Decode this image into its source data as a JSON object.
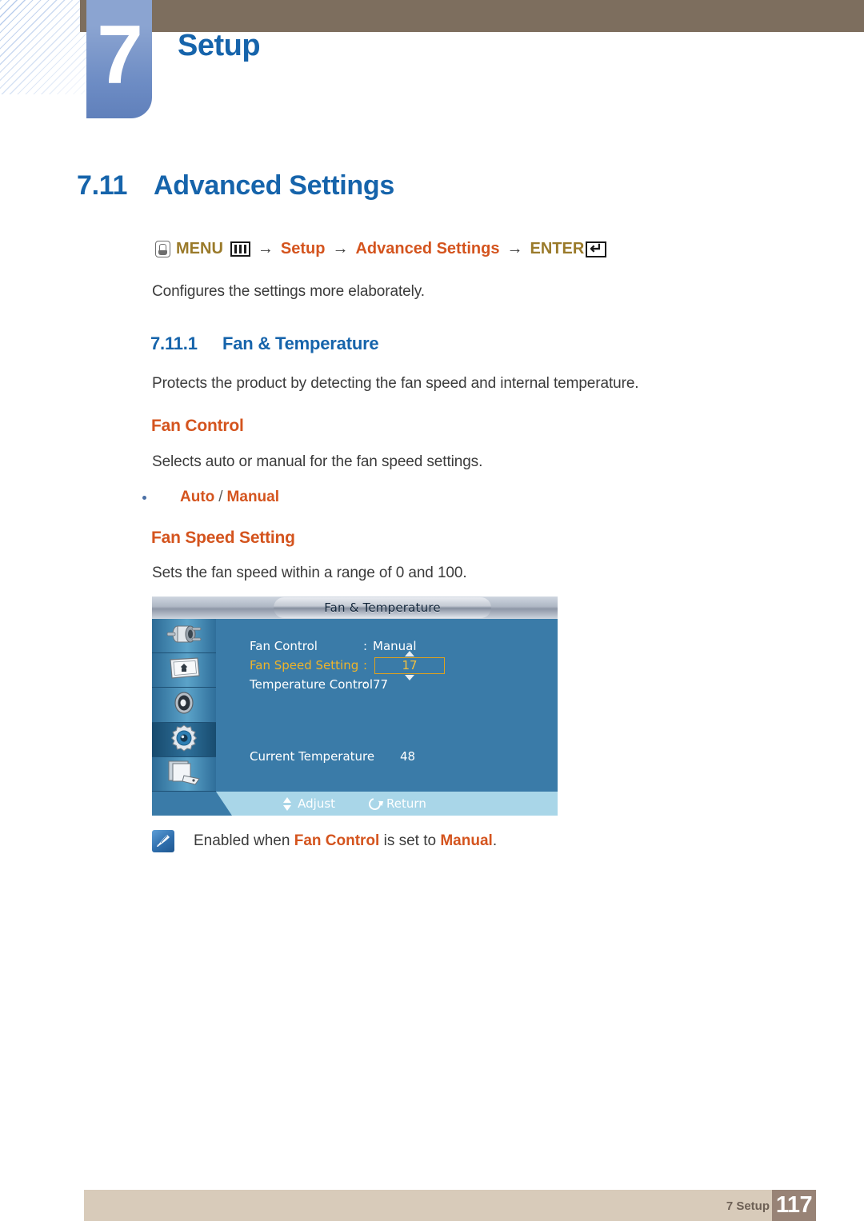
{
  "chapter": {
    "number": "7",
    "title": "Setup"
  },
  "section": {
    "number": "7.11",
    "title": "Advanced Settings"
  },
  "breadcrumb": {
    "hand_icon": "hand-press-icon",
    "menu_label": "MENU",
    "menu_icon": "menu-bars-icon",
    "arrow": "→",
    "step1": "Setup",
    "step2": "Advanced Settings",
    "enter_label": "ENTER",
    "enter_icon": "enter-key-icon"
  },
  "intro_text": "Configures the settings more elaborately.",
  "subsection": {
    "number": "7.11.1",
    "title": "Fan & Temperature",
    "description": "Protects the product by detecting the fan speed and internal temperature."
  },
  "fan_control": {
    "heading": "Fan Control",
    "description": "Selects auto or manual for the fan speed settings.",
    "option_a": "Auto",
    "separator": "/",
    "option_b": "Manual"
  },
  "fan_speed": {
    "heading": "Fan Speed Setting",
    "description": "Sets the fan speed within a range of 0 and 100."
  },
  "osd": {
    "title": "Fan & Temperature",
    "sidebar_icons": [
      "input-plug-icon",
      "picture-display-icon",
      "sound-speaker-icon",
      "setup-gear-icon",
      "multi-control-icon"
    ],
    "rows": [
      {
        "label": "Fan Control",
        "colon": ":",
        "value": "Manual"
      },
      {
        "label": "Fan Speed Setting",
        "colon": ":",
        "value": "17"
      },
      {
        "label": "Temperature Control",
        "colon": ":",
        "value": "77"
      }
    ],
    "current_temperature_label": "Current Temperature",
    "current_temperature_value": "48",
    "footer": {
      "adjust_label": "Adjust",
      "adjust_icon": "up-down-arrows-icon",
      "return_label": "Return",
      "return_icon": "return-arrow-icon"
    },
    "selected_row_index": 1
  },
  "note": {
    "icon": "note-pen-icon",
    "prefix": "Enabled when ",
    "highlight1": "Fan Control",
    "middle": " is set to ",
    "highlight2": "Manual",
    "suffix": "."
  },
  "footer": {
    "label": "7 Setup",
    "page": "117"
  },
  "colors": {
    "heading_blue": "#1664ab",
    "accent_orange": "#d4541e",
    "gold": "#9a7a2a",
    "brown_bar": "#7d6e5e",
    "footer_beige": "#d8cbba",
    "page_box": "#988376",
    "osd_blue": "#3a7ba8",
    "osd_gold": "#f0b429"
  }
}
